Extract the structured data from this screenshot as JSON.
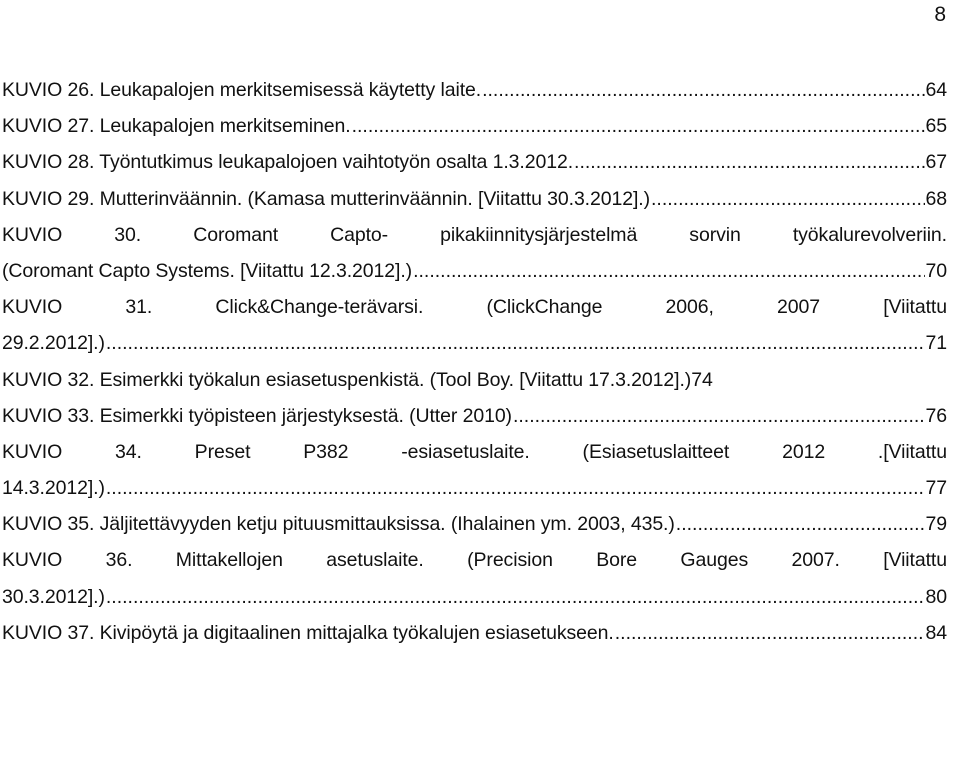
{
  "page_number": "8",
  "entries": [
    {
      "text": "KUVIO 26. Leukapalojen merkitsemisessä käytetty laite.",
      "page": "64"
    },
    {
      "text": "KUVIO 27. Leukapalojen merkitseminen.",
      "page": "65"
    },
    {
      "text": "KUVIO 28. Työntutkimus leukapalojoen vaihtotyön osalta 1.3.2012.",
      "page": "67"
    },
    {
      "text": "KUVIO 29. Mutterinväännin. (Kamasa mutterinväännin. [Viitattu 30.3.2012].)",
      "page": "68"
    },
    {
      "first_line": "KUVIO 30. Coromant Capto- pikakiinnitysjärjestelmä sorvin työkalurevolveriin.",
      "text": "(Coromant Capto Systems. [Viitattu 12.3.2012].)",
      "page": "70"
    },
    {
      "first_line": "KUVIO 31. Click&Change-terävarsi. (ClickChange 2006, 2007 [Viitattu",
      "text": "29.2.2012].)",
      "page": "71"
    },
    {
      "text": "KUVIO 32. Esimerkki työkalun esiasetuspenkistä. (Tool Boy. [Viitattu 17.3.2012].)",
      "page": "74"
    },
    {
      "text": "KUVIO 33. Esimerkki työpisteen järjestyksestä. (Utter 2010)",
      "page": "76"
    },
    {
      "first_line": "KUVIO 34. Preset P382 -esiasetuslaite. (Esiasetuslaitteet 2012 .[Viitattu",
      "text": "14.3.2012].)",
      "page": "77"
    },
    {
      "text": "KUVIO 35. Jäljitettävyyden ketju pituusmittauksissa. (Ihalainen ym. 2003, 435.)",
      "page": "79"
    },
    {
      "first_line": "KUVIO 36. Mittakellojen asetuslaite. (Precision Bore Gauges 2007. [Viitattu",
      "text": "30.3.2012].)",
      "page": "80"
    },
    {
      "text": "KUVIO 37. Kivipöytä ja digitaalinen mittajalka työkalujen esiasetukseen.",
      "page": "84"
    }
  ]
}
